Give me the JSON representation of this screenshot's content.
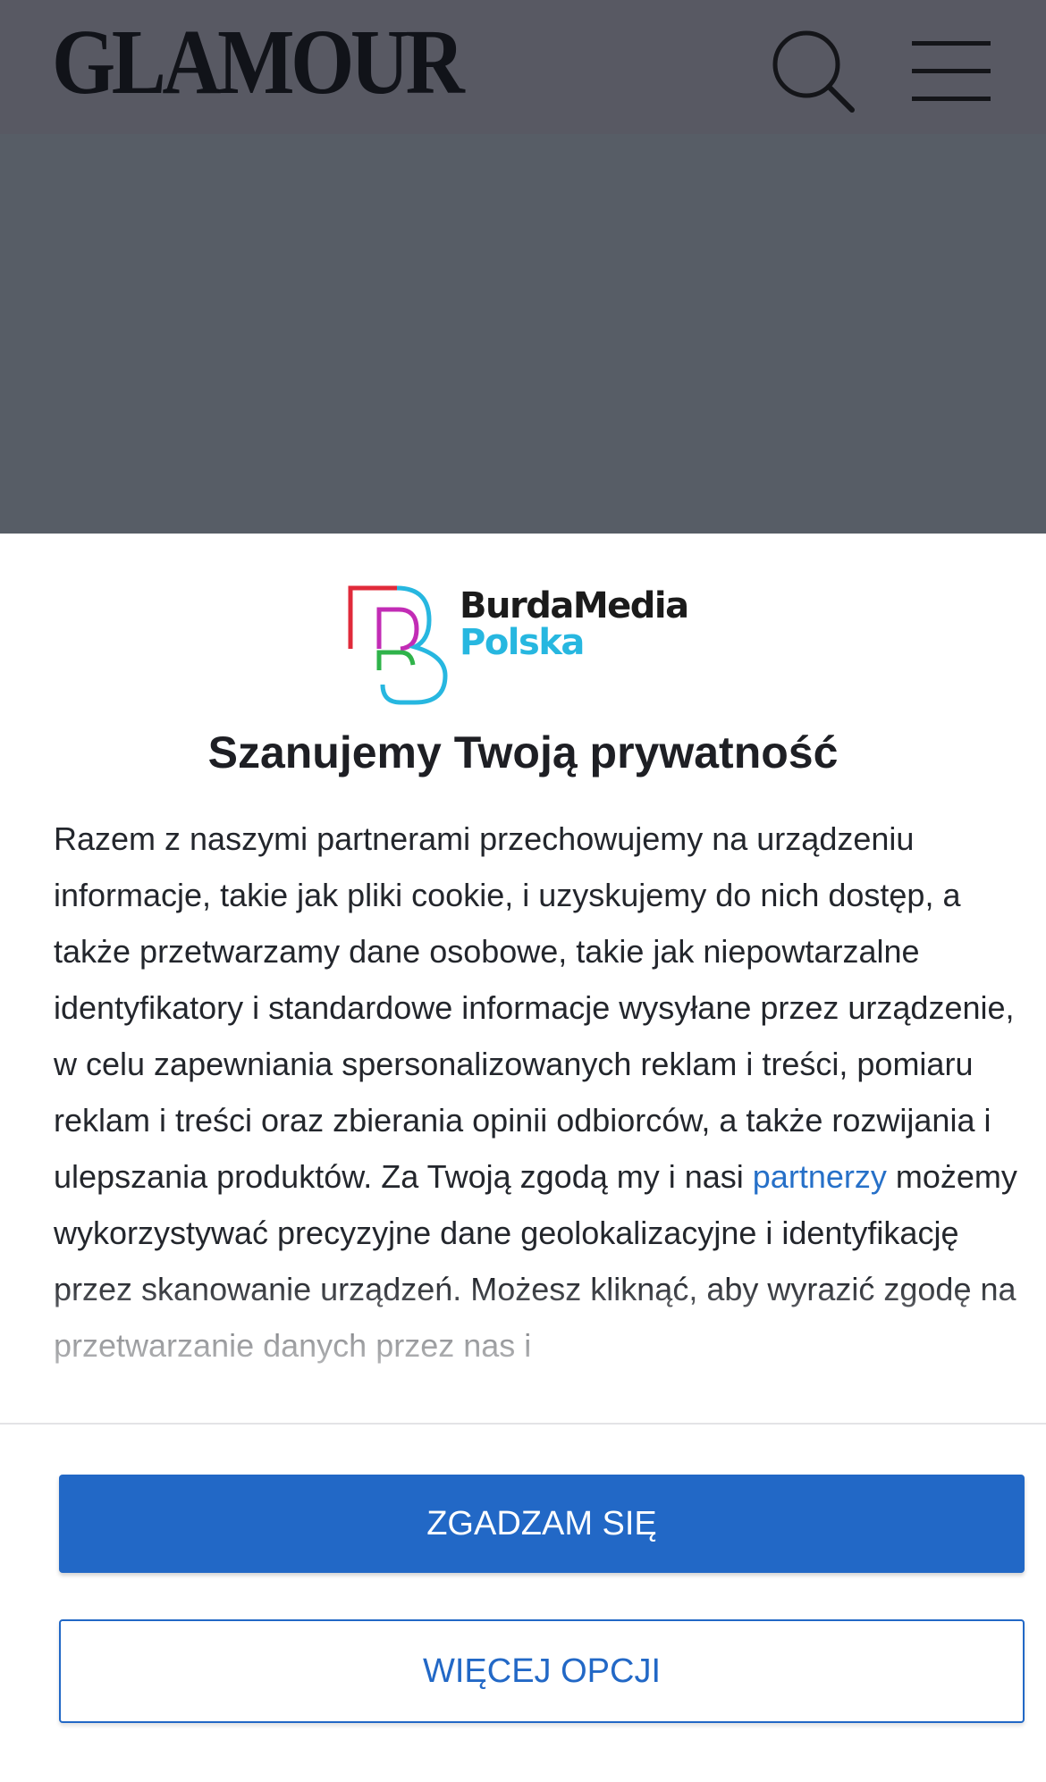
{
  "header": {
    "logo_text": "GLAMOUR",
    "search_icon": "search-icon",
    "menu_icon": "hamburger-menu-icon",
    "background_color": "#585963"
  },
  "consent": {
    "brand": {
      "line1": "BurdaMedia",
      "line2": "Polska",
      "logo_icon": "burda-b-logo-icon",
      "colors": [
        "#e02a3a",
        "#c22cb5",
        "#2fb34a",
        "#27b7e0"
      ]
    },
    "title": "Szanujemy Twoją prywatność",
    "body_part1": "Razem z naszymi partnerami przechowujemy na urządzeniu informacje, takie jak pliki cookie, i uzyskujemy do nich dostęp, a także przetwarzamy dane osobowe, takie jak niepowtarzalne identyfikatory i standardowe informacje wysyłane przez urządzenie, w celu zapewniania spersonalizowanych reklam i treści, pomiaru reklam i treści oraz zbierania opinii odbiorców, a także rozwijania i ulepszania produktów. Za Twoją zgodą my i nasi ",
    "body_link": "partnerzy",
    "body_part2": " możemy wykorzystywać precyzyjne dane geolokalizacyjne i identyfikację przez skanowanie urządzeń. Możesz kliknąć, aby wyrazić zgodę na przetwarzanie danych przez nas i",
    "accept_label": "ZGADZAM SIĘ",
    "more_options_label": "WIĘCEJ OPCJI",
    "accent_color": "#2268c6",
    "link_color": "#2670c8"
  }
}
